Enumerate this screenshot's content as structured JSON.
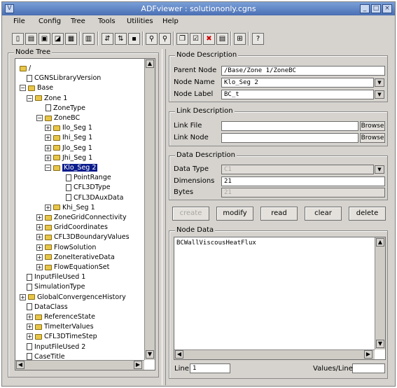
{
  "window": {
    "title": "ADFviewer : solutiononly.cgns",
    "icon": "V"
  },
  "window_buttons": [
    "minimize-icon",
    "maximize-icon",
    "close-icon"
  ],
  "menu": [
    "File",
    "Config",
    "Tree",
    "Tools",
    "Utilities",
    "Help"
  ],
  "toolbar_icons": [
    "new-file-icon",
    "open-folder-icon",
    "save-icon",
    "save-as-icon",
    "close-file-icon",
    "find-icon",
    "link-icon",
    "unlink-icon",
    "node-icon",
    "zoom-in-icon",
    "zoom-out-icon",
    "copy-icon",
    "checkbox-icon",
    "delete-icon",
    "properties-icon",
    "tree-icon",
    "help-icon"
  ],
  "node_tree": {
    "title": "Node Tree",
    "items": [
      {
        "label": "/",
        "type": "folder",
        "expander": ""
      },
      {
        "label": "CGNSLibraryVersion",
        "type": "doc",
        "expander": ""
      },
      {
        "label": "Base",
        "type": "folder",
        "expander": "−"
      },
      {
        "label": "Zone   1",
        "type": "folder",
        "expander": "−"
      },
      {
        "label": "ZoneType",
        "type": "doc",
        "expander": ""
      },
      {
        "label": "ZoneBC",
        "type": "folder",
        "expander": "−"
      },
      {
        "label": "Ilo_Seg   1",
        "type": "folder",
        "expander": "+"
      },
      {
        "label": "Ihi_Seg   1",
        "type": "folder",
        "expander": "+"
      },
      {
        "label": "Jlo_Seg   1",
        "type": "folder",
        "expander": "+"
      },
      {
        "label": "Jhi_Seg   1",
        "type": "folder",
        "expander": "+"
      },
      {
        "label": "Klo_Seg   2",
        "type": "folder",
        "expander": "−",
        "selected": true
      },
      {
        "label": "PointRange",
        "type": "doc",
        "expander": ""
      },
      {
        "label": "CFL3DType",
        "type": "doc",
        "expander": ""
      },
      {
        "label": "CFL3DAuxData",
        "type": "doc",
        "expander": ""
      },
      {
        "label": "Khi_Seg   1",
        "type": "folder",
        "expander": "+"
      },
      {
        "label": "ZoneGridConnectivity",
        "type": "folder",
        "expander": "+"
      },
      {
        "label": "GridCoordinates",
        "type": "folder",
        "expander": "+"
      },
      {
        "label": "CFL3DBoundaryValues",
        "type": "folder",
        "expander": "+"
      },
      {
        "label": "FlowSolution",
        "type": "folder",
        "expander": "+"
      },
      {
        "label": "ZoneIterativeData",
        "type": "folder",
        "expander": "+"
      },
      {
        "label": "FlowEquationSet",
        "type": "folder",
        "expander": "+"
      },
      {
        "label": "InputFileUsed 1",
        "type": "doc",
        "expander": ""
      },
      {
        "label": "SimulationType",
        "type": "doc",
        "expander": ""
      },
      {
        "label": "GlobalConvergenceHistory",
        "type": "folder",
        "expander": "+"
      },
      {
        "label": "DataClass",
        "type": "doc",
        "expander": ""
      },
      {
        "label": "ReferenceState",
        "type": "folder",
        "expander": "+"
      },
      {
        "label": "TimeIterValues",
        "type": "folder",
        "expander": "+"
      },
      {
        "label": "CFL3DTimeStep",
        "type": "folder",
        "expander": "+"
      },
      {
        "label": "InputFileUsed 2",
        "type": "doc",
        "expander": ""
      },
      {
        "label": "CaseTitle",
        "type": "doc",
        "expander": ""
      }
    ]
  },
  "node_description": {
    "title": "Node Description",
    "parent_node_label": "Parent Node",
    "parent_node_value": "/Base/Zone   1/ZoneBC",
    "node_name_label": "Node Name",
    "node_name_value": "Klo_Seg   2",
    "node_label_label": "Node Label",
    "node_label_value": "BC_t"
  },
  "link_description": {
    "title": "Link Description",
    "link_file_label": "Link File",
    "link_file_value": "",
    "link_node_label": "Link Node",
    "link_node_value": "",
    "browse_label": "Browse"
  },
  "data_description": {
    "title": "Data Description",
    "data_type_label": "Data Type",
    "data_type_value": "C1",
    "dimensions_label": "Dimensions",
    "dimensions_value": "21",
    "bytes_label": "Bytes",
    "bytes_value": "21"
  },
  "actions": {
    "create": "create",
    "modify": "modify",
    "read": "read",
    "clear": "clear",
    "delete": "delete"
  },
  "node_data": {
    "title": "Node Data",
    "content": "BCWallViscousHeatFlux",
    "line_label": "Line",
    "line_value": "1",
    "values_per_line_label": "Values/Line",
    "values_per_line_value": ""
  },
  "colors": {
    "title_bar": "#4a6fb3",
    "selection": "#0b1c8c",
    "window_bg": "#d6d3ce",
    "folder": "#e7c64a"
  }
}
